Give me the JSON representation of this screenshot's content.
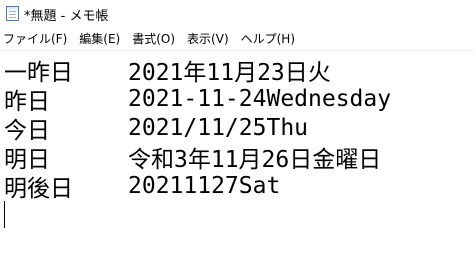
{
  "window": {
    "title": "*無題 - メモ帳"
  },
  "menu": {
    "items": [
      {
        "label": "ファイル(F)"
      },
      {
        "label": "編集(E)"
      },
      {
        "label": "書式(O)"
      },
      {
        "label": "表示(V)"
      },
      {
        "label": "ヘルプ(H)"
      }
    ]
  },
  "editor": {
    "lines": [
      {
        "label": "一昨日",
        "value": "2021年11月23日火"
      },
      {
        "label": "昨日",
        "value": "2021-11-24Wednesday"
      },
      {
        "label": "今日",
        "value": "2021/11/25Thu"
      },
      {
        "label": "明日",
        "value": "令和3年11月26日金曜日"
      },
      {
        "label": "明後日",
        "value": "20211127Sat"
      }
    ]
  },
  "icons": {
    "app_icon": "notepad-icon"
  }
}
